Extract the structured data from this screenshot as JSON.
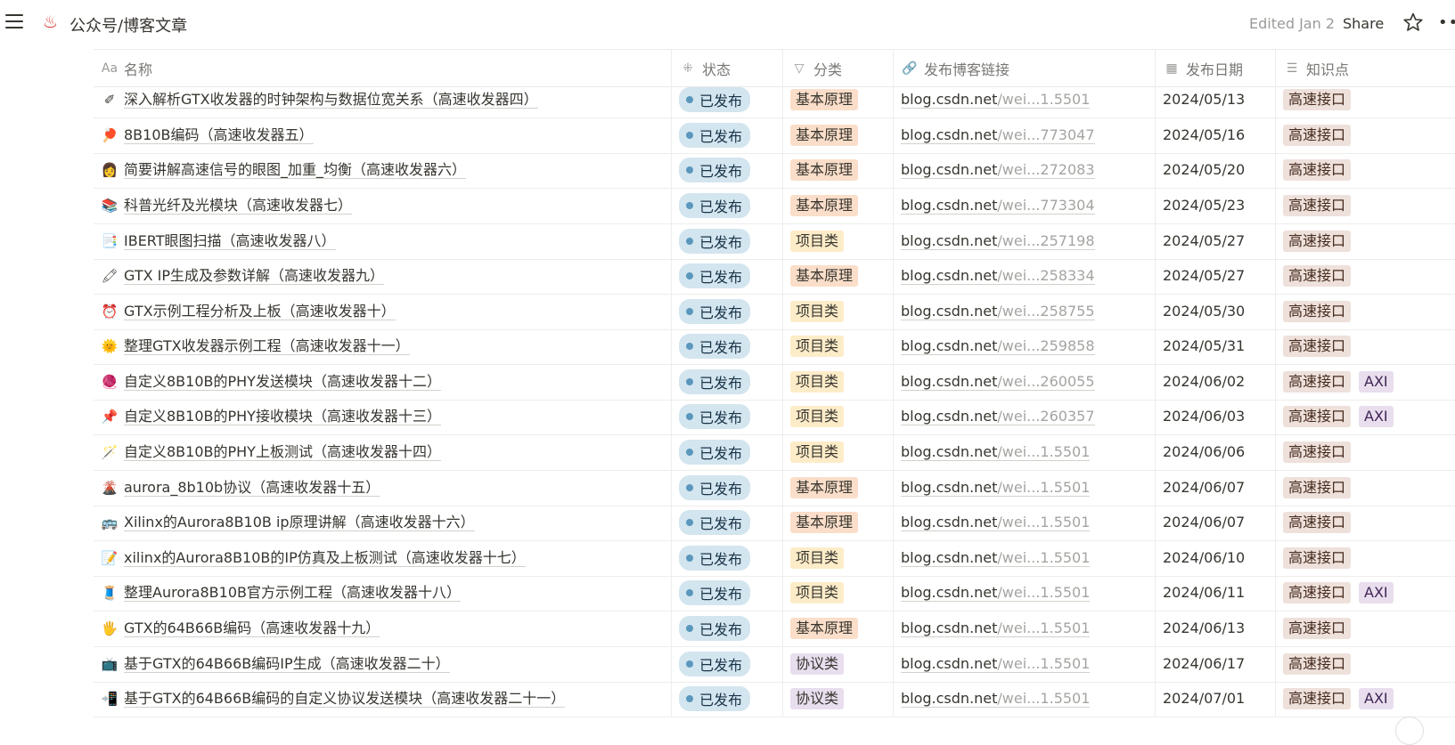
{
  "topbar": {
    "menu_icon": "hamburger-icon",
    "page_icon": "hot-springs-icon",
    "page_icon_glyph": "♨",
    "title": "公众号/博客文章",
    "edited": "Edited Jan 2",
    "share": "Share",
    "star_icon": "star-icon",
    "more_icon": "more-horizontal-icon",
    "more_glyph": "••"
  },
  "table": {
    "headers": [
      {
        "icon": "text-type-icon",
        "glyph": "Aa",
        "label": "名称"
      },
      {
        "icon": "status-spinner-icon",
        "glyph": "⁜",
        "label": "状态"
      },
      {
        "icon": "select-circle-icon",
        "glyph": "▽",
        "label": "分类"
      },
      {
        "icon": "link-icon",
        "glyph": "🔗",
        "label": "发布博客链接"
      },
      {
        "icon": "calendar-icon",
        "glyph": "▦",
        "label": "发布日期"
      },
      {
        "icon": "list-icon",
        "glyph": "☰",
        "label": "知识点"
      }
    ],
    "rows": [
      {
        "icon": "pen-icon",
        "glyph": "✐",
        "title": "深入解析GTX收发器的时钟架构与数据位宽关系（高速收发器四）",
        "status": "已发布",
        "category": "基本原理",
        "link_main": "blog.csdn.net",
        "link_dim": "/wei...1.5501",
        "date": "2024/05/13",
        "tags": [
          "高速接口"
        ]
      },
      {
        "icon": "ping-pong-icon",
        "glyph": "🏓",
        "title": "8B10B编码（高速收发器五）",
        "status": "已发布",
        "category": "基本原理",
        "link_main": "blog.csdn.net",
        "link_dim": "/wei...773047",
        "date": "2024/05/16",
        "tags": [
          "高速接口"
        ]
      },
      {
        "icon": "person-icon",
        "glyph": "👩",
        "title": "简要讲解高速信号的眼图_加重_均衡（高速收发器六）",
        "status": "已发布",
        "category": "基本原理",
        "link_main": "blog.csdn.net",
        "link_dim": "/wei...272083",
        "date": "2024/05/20",
        "tags": [
          "高速接口"
        ]
      },
      {
        "icon": "books-icon",
        "glyph": "📚",
        "title": "科普光纤及光模块（高速收发器七）",
        "status": "已发布",
        "category": "基本原理",
        "link_main": "blog.csdn.net",
        "link_dim": "/wei...773304",
        "date": "2024/05/23",
        "tags": [
          "高速接口"
        ]
      },
      {
        "icon": "document-icon",
        "glyph": "📑",
        "title": "IBERT眼图扫描（高速收发器八）",
        "status": "已发布",
        "category": "项目类",
        "link_main": "blog.csdn.net",
        "link_dim": "/wei...257198",
        "date": "2024/05/27",
        "tags": [
          "高速接口"
        ]
      },
      {
        "icon": "brush-icon",
        "glyph": "🖍",
        "title": "GTX IP生成及参数详解（高速收发器九）",
        "status": "已发布",
        "category": "基本原理",
        "link_main": "blog.csdn.net",
        "link_dim": "/wei...258334",
        "date": "2024/05/27",
        "tags": [
          "高速接口"
        ]
      },
      {
        "icon": "alarm-clock-icon",
        "glyph": "⏰",
        "title": "GTX示例工程分析及上板（高速收发器十）",
        "status": "已发布",
        "category": "项目类",
        "link_main": "blog.csdn.net",
        "link_dim": "/wei...258755",
        "date": "2024/05/30",
        "tags": [
          "高速接口"
        ]
      },
      {
        "icon": "sun-icon",
        "glyph": "🌞",
        "title": "整理GTX收发器示例工程（高速收发器十一）",
        "status": "已发布",
        "category": "项目类",
        "link_main": "blog.csdn.net",
        "link_dim": "/wei...259858",
        "date": "2024/05/31",
        "tags": [
          "高速接口"
        ]
      },
      {
        "icon": "yarn-icon",
        "glyph": "🧶",
        "title": "自定义8B10B的PHY发送模块（高速收发器十二）",
        "status": "已发布",
        "category": "项目类",
        "link_main": "blog.csdn.net",
        "link_dim": "/wei...260055",
        "date": "2024/06/02",
        "tags": [
          "高速接口",
          "AXI"
        ]
      },
      {
        "icon": "pushpin-icon",
        "glyph": "📌",
        "title": "自定义8B10B的PHY接收模块（高速收发器十三）",
        "status": "已发布",
        "category": "项目类",
        "link_main": "blog.csdn.net",
        "link_dim": "/wei...260357",
        "date": "2024/06/03",
        "tags": [
          "高速接口",
          "AXI"
        ]
      },
      {
        "icon": "magic-wand-icon",
        "glyph": "🪄",
        "title": "自定义8B10B的PHY上板测试（高速收发器十四）",
        "status": "已发布",
        "category": "项目类",
        "link_main": "blog.csdn.net",
        "link_dim": "/wei...1.5501",
        "date": "2024/06/06",
        "tags": [
          "高速接口"
        ]
      },
      {
        "icon": "volcano-icon",
        "glyph": "🌋",
        "title": "aurora_8b10b协议（高速收发器十五）",
        "status": "已发布",
        "category": "基本原理",
        "link_main": "blog.csdn.net",
        "link_dim": "/wei...1.5501",
        "date": "2024/06/07",
        "tags": [
          "高速接口"
        ]
      },
      {
        "icon": "bus-icon",
        "glyph": "🚌",
        "title": "Xilinx的Aurora8B10B ip原理讲解（高速收发器十六）",
        "status": "已发布",
        "category": "基本原理",
        "link_main": "blog.csdn.net",
        "link_dim": "/wei...1.5501",
        "date": "2024/06/07",
        "tags": [
          "高速接口"
        ]
      },
      {
        "icon": "note-icon",
        "glyph": "📝",
        "title": "xilinx的Aurora8B10B的IP仿真及上板测试（高速收发器十七）",
        "status": "已发布",
        "category": "项目类",
        "link_main": "blog.csdn.net",
        "link_dim": "/wei...1.5501",
        "date": "2024/06/10",
        "tags": [
          "高速接口"
        ]
      },
      {
        "icon": "thread-spool-icon",
        "glyph": "🧵",
        "title": "整理Aurora8B10B官方示例工程（高速收发器十八）",
        "status": "已发布",
        "category": "项目类",
        "link_main": "blog.csdn.net",
        "link_dim": "/wei...1.5501",
        "date": "2024/06/11",
        "tags": [
          "高速接口",
          "AXI"
        ]
      },
      {
        "icon": "hand-icon",
        "glyph": "🖐",
        "title": "GTX的64B66B编码（高速收发器十九）",
        "status": "已发布",
        "category": "基本原理",
        "link_main": "blog.csdn.net",
        "link_dim": "/wei...1.5501",
        "date": "2024/06/13",
        "tags": [
          "高速接口"
        ]
      },
      {
        "icon": "tv-icon",
        "glyph": "📺",
        "title": "基于GTX的64B66B编码IP生成（高速收发器二十）",
        "status": "已发布",
        "category": "协议类",
        "link_main": "blog.csdn.net",
        "link_dim": "/wei...1.5501",
        "date": "2024/06/17",
        "tags": [
          "高速接口"
        ]
      },
      {
        "icon": "phone-icon",
        "glyph": "📲",
        "title": "基于GTX的64B66B编码的自定义协议发送模块（高速收发器二十一）",
        "status": "已发布",
        "category": "协议类",
        "link_main": "blog.csdn.net",
        "link_dim": "/wei...1.5501",
        "date": "2024/07/01",
        "tags": [
          "高速接口",
          "AXI"
        ]
      }
    ]
  },
  "colors": {
    "status_bg": "#d3e5ef",
    "status_dot": "#5b97bd",
    "cat_基本原理": "#fadec9",
    "cat_项目类": "#fdecc8",
    "cat_协议类": "#e8deee",
    "tag_高速接口": "#eee0da",
    "tag_AXI": "#e8deee"
  }
}
